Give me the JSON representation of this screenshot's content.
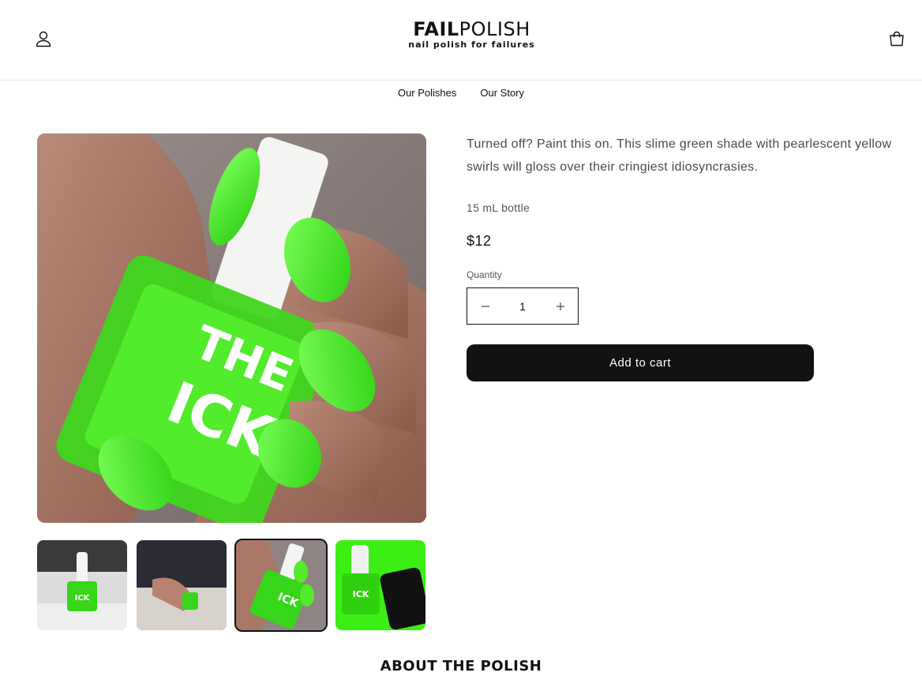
{
  "header": {
    "logo_primary": "FAIL",
    "logo_secondary": "POLISH",
    "logo_tagline": "nail polish for failures",
    "account_icon": "account-icon",
    "cart_icon": "cart-icon"
  },
  "nav": {
    "items": [
      {
        "label": "Our Polishes"
      },
      {
        "label": "Our Story"
      }
    ]
  },
  "product": {
    "polish_color": "#35e11f",
    "bottle_label_line1": "THE",
    "bottle_label_line2": "ICK",
    "description": "Turned off? Paint this on. This slime green shade with pearlescent yellow swirls will gloss over their cringiest idiosyncrasies.",
    "size": "15 mL bottle",
    "price": "$12",
    "quantity_label": "Quantity",
    "quantity_value": "1",
    "add_to_cart_label": "Add to cart",
    "thumbnails": [
      {
        "name": "bottle on white table"
      },
      {
        "name": "hand on cushion"
      },
      {
        "name": "hand holding bottle",
        "active": true
      },
      {
        "name": "bottle with phone"
      }
    ]
  },
  "section": {
    "about_title": "ABOUT THE POLISH"
  }
}
